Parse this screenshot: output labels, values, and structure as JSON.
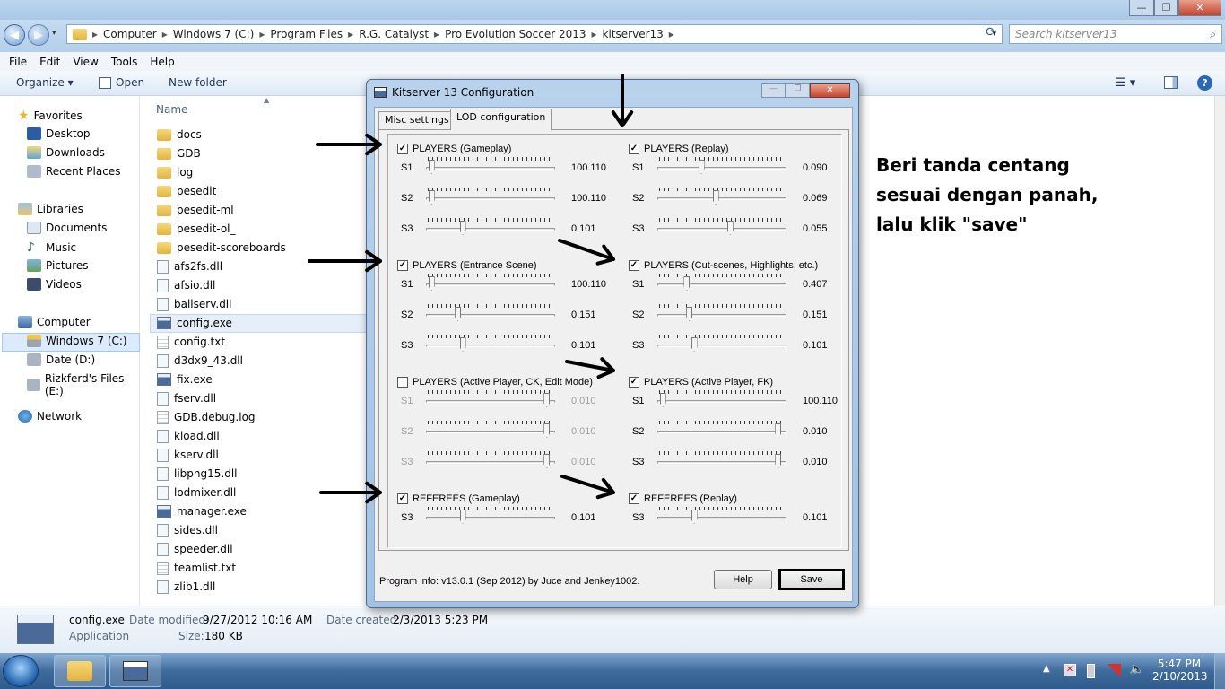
{
  "window": {
    "minimize": "—",
    "maximize": "❐",
    "close": "✕"
  },
  "address": {
    "crumbs": [
      "Computer",
      "Windows 7 (C:)",
      "Program Files",
      "R.G. Catalyst",
      "Pro Evolution Soccer 2013",
      "kitserver13"
    ],
    "search_placeholder": "Search kitserver13"
  },
  "menu": [
    "File",
    "Edit",
    "View",
    "Tools",
    "Help"
  ],
  "toolbar": {
    "organize": "Organize ▾",
    "open": "Open",
    "new_folder": "New folder"
  },
  "nav": {
    "favorites": "Favorites",
    "desktop": "Desktop",
    "downloads": "Downloads",
    "recent": "Recent Places",
    "libraries": "Libraries",
    "documents": "Documents",
    "music": "Music",
    "pictures": "Pictures",
    "videos": "Videos",
    "computer": "Computer",
    "c_drive": "Windows 7 (C:)",
    "d_drive": "Date (D:)",
    "e_drive": "Rizkferd's Files (E:)",
    "network": "Network"
  },
  "filelist": {
    "header": "Name",
    "items": [
      {
        "name": "docs",
        "type": "folder"
      },
      {
        "name": "GDB",
        "type": "folder"
      },
      {
        "name": "log",
        "type": "folder"
      },
      {
        "name": "pesedit",
        "type": "folder"
      },
      {
        "name": "pesedit-ml",
        "type": "folder"
      },
      {
        "name": "pesedit-ol_",
        "type": "folder"
      },
      {
        "name": "pesedit-scoreboards",
        "type": "folder"
      },
      {
        "name": "afs2fs.dll",
        "type": "dll"
      },
      {
        "name": "afsio.dll",
        "type": "dll"
      },
      {
        "name": "ballserv.dll",
        "type": "dll"
      },
      {
        "name": "config.exe",
        "type": "exe"
      },
      {
        "name": "config.txt",
        "type": "txt"
      },
      {
        "name": "d3dx9_43.dll",
        "type": "dll"
      },
      {
        "name": "fix.exe",
        "type": "exe"
      },
      {
        "name": "fserv.dll",
        "type": "dll"
      },
      {
        "name": "GDB.debug.log",
        "type": "txt"
      },
      {
        "name": "kload.dll",
        "type": "dll"
      },
      {
        "name": "kserv.dll",
        "type": "dll"
      },
      {
        "name": "libpng15.dll",
        "type": "dll"
      },
      {
        "name": "lodmixer.dll",
        "type": "dll"
      },
      {
        "name": "manager.exe",
        "type": "exe"
      },
      {
        "name": "sides.dll",
        "type": "dll"
      },
      {
        "name": "speeder.dll",
        "type": "dll"
      },
      {
        "name": "teamlist.txt",
        "type": "txt"
      },
      {
        "name": "zlib1.dll",
        "type": "dll"
      }
    ]
  },
  "details": {
    "name": "config.exe",
    "type": "Application",
    "modified_label": "Date modified:",
    "modified": "9/27/2012 10:16 AM",
    "created_label": "Date created:",
    "created": "2/3/2013 5:23 PM",
    "size_label": "Size:",
    "size": "180 KB"
  },
  "dialog": {
    "title": "Kitserver 13 Configuration",
    "tabs": [
      "Misc settings",
      "LOD configuration"
    ],
    "groups": {
      "g1": {
        "label": "PLAYERS (Gameplay)",
        "checked": true,
        "s1": "100.110",
        "s2": "100.110",
        "s3": "0.101"
      },
      "g2": {
        "label": "PLAYERS (Replay)",
        "checked": true,
        "s1": "0.090",
        "s2": "0.069",
        "s3": "0.055"
      },
      "g3": {
        "label": "PLAYERS (Entrance Scene)",
        "checked": true,
        "s1": "100.110",
        "s2": "0.151",
        "s3": "0.101"
      },
      "g4": {
        "label": "PLAYERS (Cut-scenes, Highlights, etc.)",
        "checked": true,
        "s1": "0.407",
        "s2": "0.151",
        "s3": "0.101"
      },
      "g5": {
        "label": "PLAYERS (Active Player, CK, Edit Mode)",
        "checked": false,
        "s1": "0.010",
        "s2": "0.010",
        "s3": "0.010"
      },
      "g6": {
        "label": "PLAYERS (Active Player, FK)",
        "checked": true,
        "s1": "100.110",
        "s2": "0.010",
        "s3": "0.010"
      },
      "g7": {
        "label": "REFEREES (Gameplay)",
        "checked": true,
        "s3": "0.101"
      },
      "g8": {
        "label": "REFEREES (Replay)",
        "checked": true,
        "s3": "0.101"
      }
    },
    "slider_labels": {
      "s1": "S1",
      "s2": "S2",
      "s3": "S3"
    },
    "program_info": "Program info: v13.0.1 (Sep 2012) by Juce and Jenkey1002.",
    "help": "Help",
    "save": "Save"
  },
  "annotation": {
    "line1": "Beri tanda centang",
    "line2": "sesuai dengan panah,",
    "line3": "lalu klik \"save\""
  },
  "clock": {
    "time": "5:47 PM",
    "date": "2/10/2013"
  }
}
